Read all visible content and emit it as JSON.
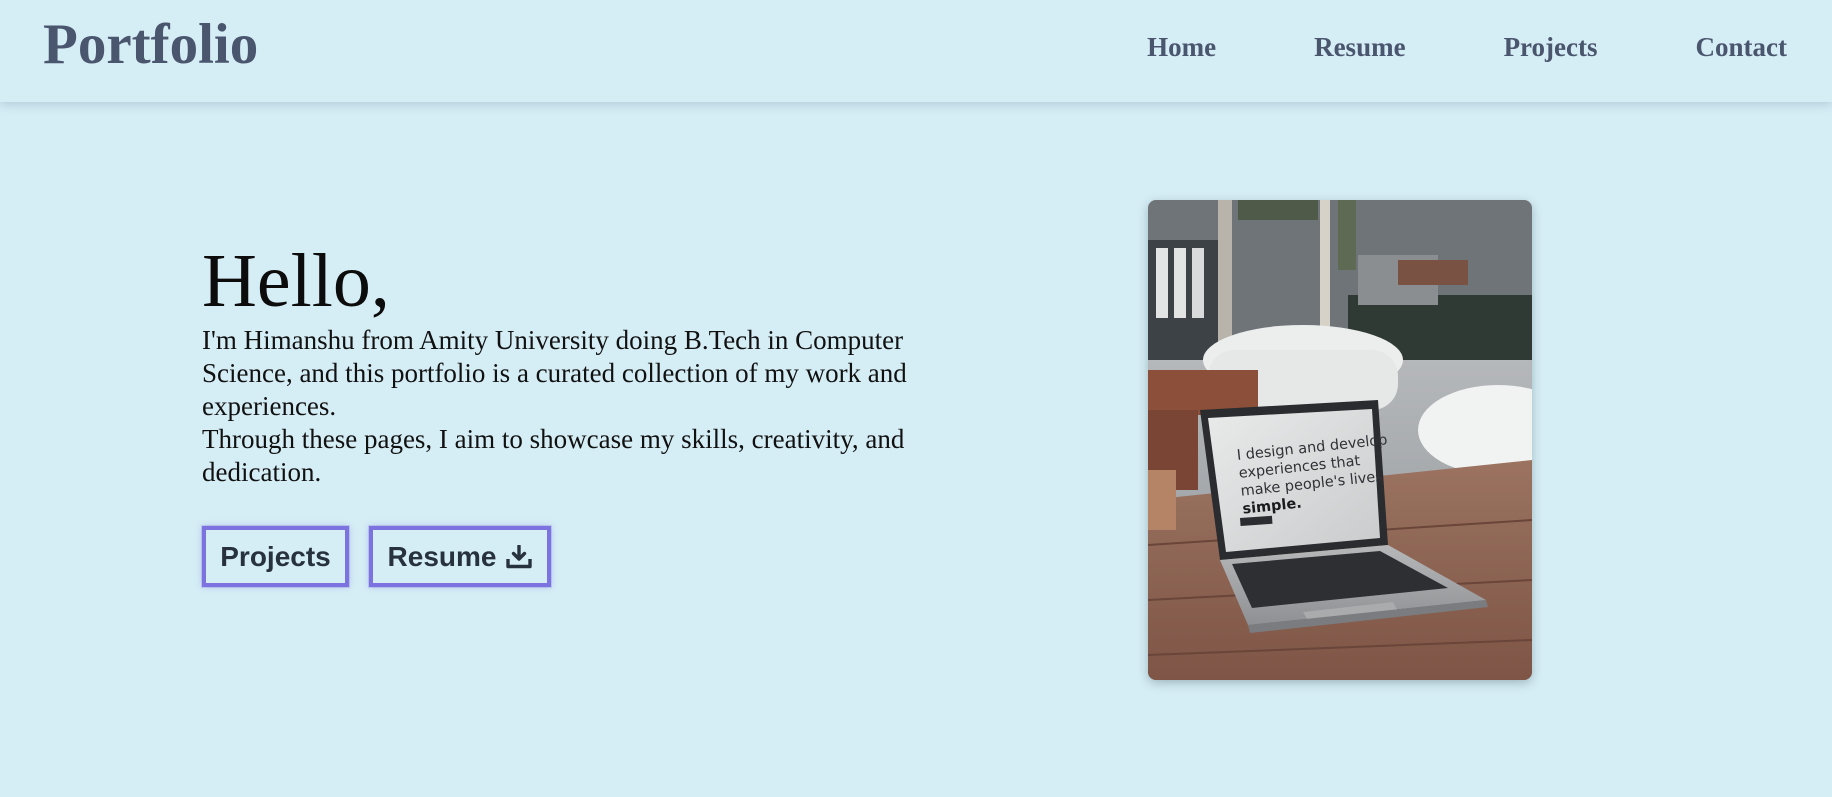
{
  "header": {
    "brand": "Portfolio",
    "nav": [
      "Home",
      "Resume",
      "Projects",
      "Contact"
    ]
  },
  "hero": {
    "greeting": "Hello,",
    "intro_line1": "I'm Himanshu from Amity University doing B.Tech in Computer Science, and this portfolio is a curated collection of my work and experiences.",
    "intro_line2": "Through these pages, I aim to showcase my skills, creativity, and dedication.",
    "buttons": {
      "projects": "Projects",
      "resume": "Resume",
      "resume_icon": "download-icon"
    }
  },
  "photo": {
    "screen_text": "I design and develop experiences that make people's lives",
    "screen_text_bold": "simple."
  },
  "colors": {
    "background": "#d5edf5",
    "nav_text": "#4a556e",
    "button_border": "#7c73e0",
    "button_text": "#27323e"
  }
}
